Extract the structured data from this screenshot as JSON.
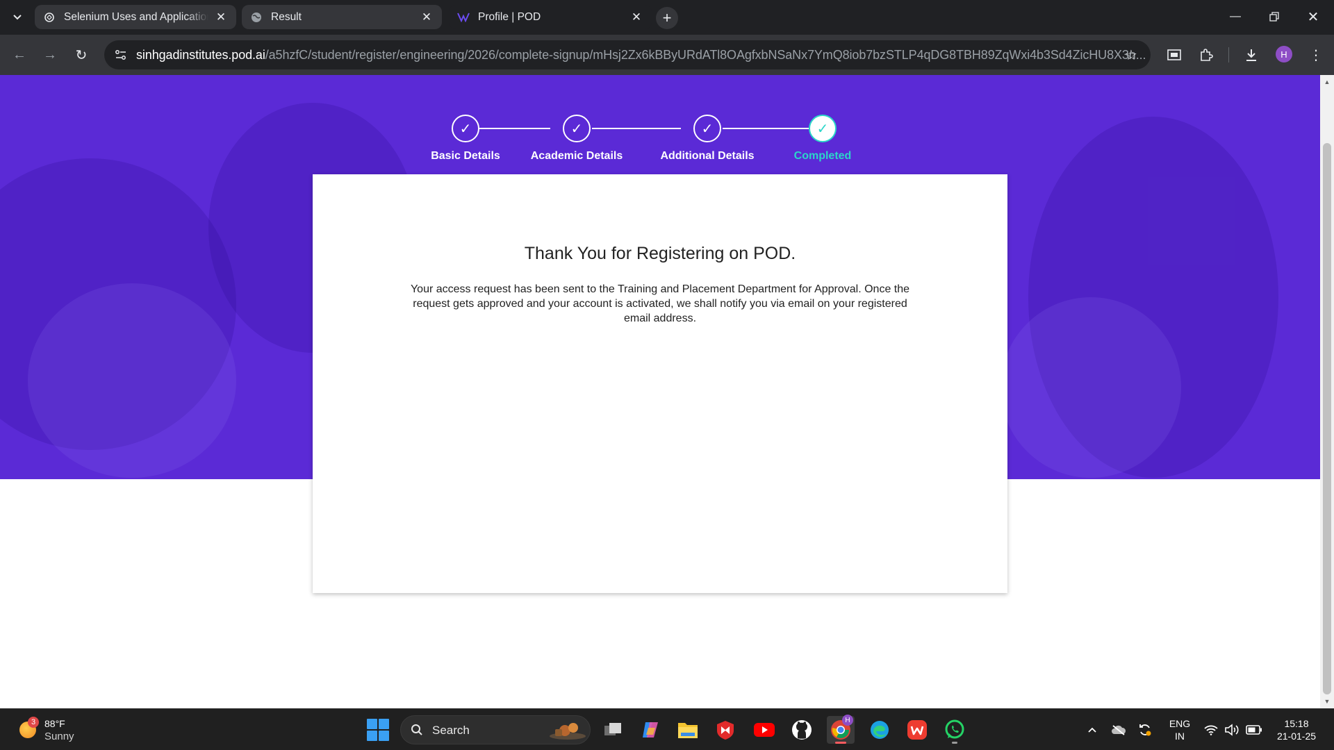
{
  "browser": {
    "tabs": [
      {
        "title": "Selenium Uses and Applications",
        "icon": "chatgpt-icon",
        "active": false
      },
      {
        "title": "Result",
        "icon": "globe-icon",
        "active": false
      },
      {
        "title": "Profile | POD",
        "icon": "pod-logo-icon",
        "active": true
      }
    ],
    "address": {
      "host": "sinhgadinstitutes.pod.ai",
      "path": "/a5hzfC/student/register/engineering/2026/complete-signup/mHsj2Zx6kBByURdATl8OAgfxbNSaNx7YmQ8iob7bzSTLP4qDG8TBH89ZqWxi4b3Sd4ZicHU8X3n..."
    },
    "profile_initial": "H"
  },
  "stepper": {
    "steps": [
      {
        "label": "Basic Details",
        "check": "✓",
        "completed": false
      },
      {
        "label": "Academic Details",
        "check": "✓",
        "completed": false
      },
      {
        "label": "Additional Details",
        "check": "✓",
        "completed": false
      },
      {
        "label": "Completed",
        "check": "✓",
        "completed": true
      }
    ]
  },
  "card": {
    "title": "Thank You for Registering on POD.",
    "message": "Your access request has been sent to the Training and Placement Department for Approval. Once the request gets approved and your account is activated, we shall notify you via email on your registered email address."
  },
  "taskbar": {
    "weather": {
      "temp": "88°F",
      "condition": "Sunny",
      "badge": "3"
    },
    "search_label": "Search",
    "apps": [
      "task-view-icon",
      "copilot-icon",
      "file-explorer-icon",
      "mcafee-icon",
      "youtube-icon",
      "github-icon",
      "chrome-icon",
      "edge-icon",
      "wps-office-icon",
      "whatsapp-icon"
    ],
    "chrome_badge": "H",
    "language": {
      "line1": "ENG",
      "line2": "IN"
    },
    "clock": {
      "time": "15:18",
      "date": "21-01-25"
    }
  },
  "colors": {
    "hero_bg": "#5b2ad6",
    "accent_teal": "#2bd6c9",
    "tabbar_bg": "#202124",
    "toolbar_bg": "#35363a",
    "taskbar_bg": "#202020"
  }
}
